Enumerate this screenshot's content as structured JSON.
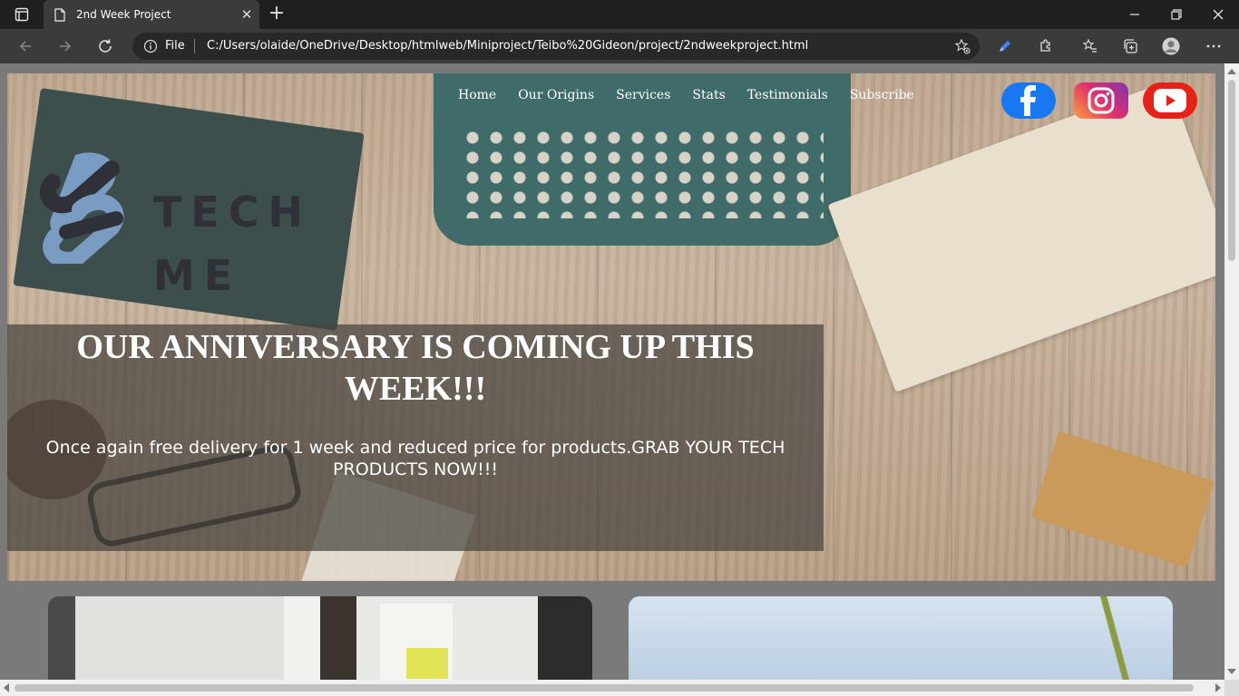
{
  "browser": {
    "tab_title": "2nd Week Project",
    "address_scheme": "File",
    "url": "C:/Users/olaide/OneDrive/Desktop/htmlweb/Miniproject/Teibo%20Gideon/project/2ndweekproject.html"
  },
  "site": {
    "logo": {
      "line1": "TECH",
      "line2": "ME",
      "colors": {
        "mark_light": "#7a9cc2",
        "mark_dark": "#2f3038"
      }
    },
    "nav": [
      "Home",
      "Our Origins",
      "Services",
      "Stats",
      "Testimonials",
      "Subscribe"
    ],
    "social": [
      {
        "name": "facebook-icon",
        "color": "#1877f2"
      },
      {
        "name": "instagram-icon",
        "color": "#d6249f"
      },
      {
        "name": "youtube-icon",
        "color": "#e62117"
      }
    ],
    "banner": {
      "heading": "OUR ANNIVERSARY IS COMING UP THIS WEEK!!!",
      "text": "Once again free delivery for 1 week and reduced price for products.GRAB YOUR TECH PRODUCTS NOW!!!"
    }
  }
}
